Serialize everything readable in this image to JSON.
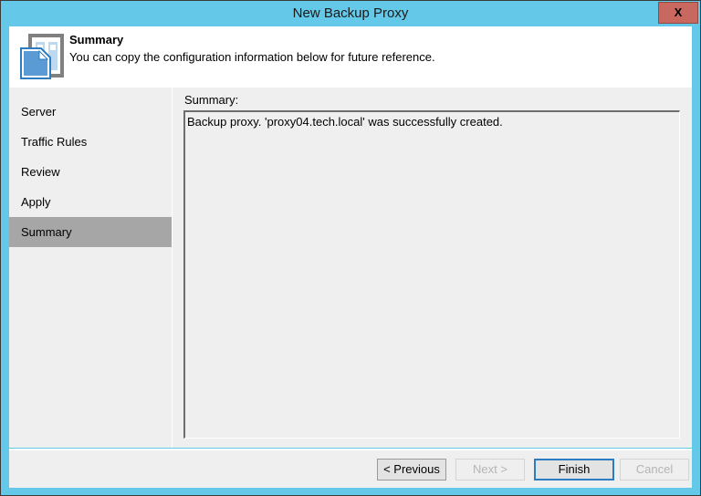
{
  "window": {
    "title": "New Backup Proxy",
    "close_label": "X",
    "titlebar_color": "#64c8e8",
    "close_color": "#c9685f"
  },
  "header": {
    "title": "Summary",
    "subtitle": "You can copy the configuration information below for future reference.",
    "icon": "backup-proxy-server-icon"
  },
  "sidebar": {
    "items": [
      {
        "label": "Server",
        "selected": false
      },
      {
        "label": "Traffic Rules",
        "selected": false
      },
      {
        "label": "Review",
        "selected": false
      },
      {
        "label": "Apply",
        "selected": false
      },
      {
        "label": "Summary",
        "selected": true
      }
    ],
    "selected_color": "#a6a6a6"
  },
  "main": {
    "summary_label": "Summary:",
    "summary_text": "Backup proxy. 'proxy04.tech.local' was successfully created."
  },
  "footer": {
    "buttons": [
      {
        "label": "< Previous",
        "state": "enabled"
      },
      {
        "label": "Next >",
        "state": "disabled"
      },
      {
        "label": "Finish",
        "state": "default"
      },
      {
        "label": "Cancel",
        "state": "disabled"
      }
    ]
  }
}
